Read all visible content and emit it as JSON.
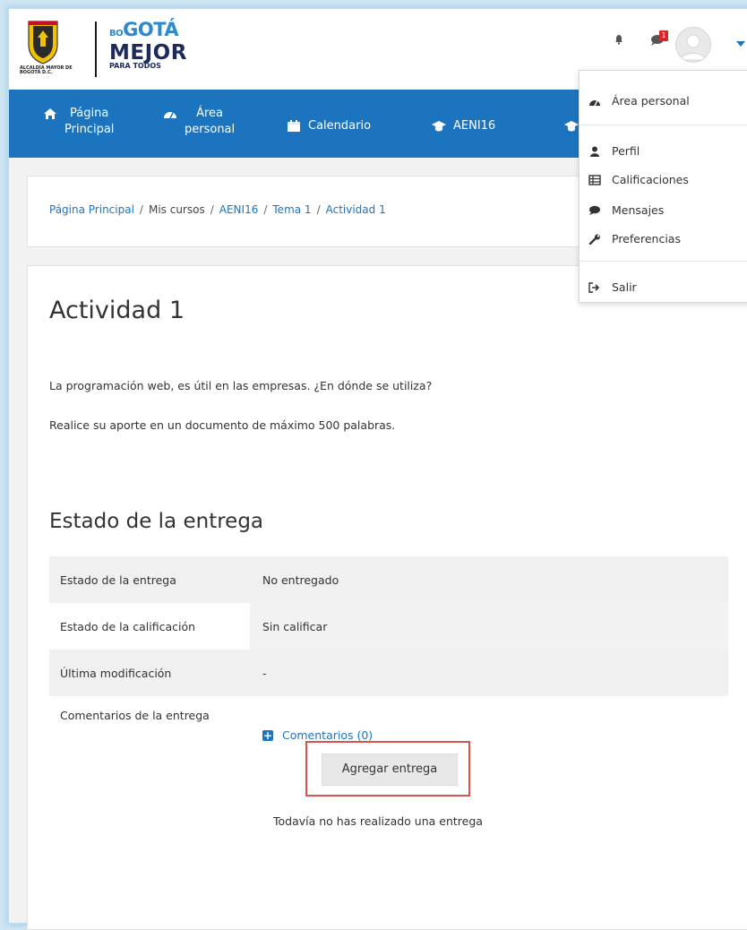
{
  "logo": {
    "crest_caption": "ALCALDÍA MAYOR DE BOGOTÁ D.C.",
    "brand_line1_prefix": "BO",
    "brand_line1": "GOTÁ",
    "brand_line2": "MEJOR",
    "brand_line3": "PARA TODOS"
  },
  "header": {
    "notification_count": "1"
  },
  "nav": {
    "items": [
      {
        "label": "Página Principal",
        "line1": "Página",
        "line2": "Principal",
        "icon": "home-icon"
      },
      {
        "label": "Área personal",
        "line1": "Área",
        "line2": "personal",
        "icon": "dashboard-icon"
      },
      {
        "label": "Calendario",
        "icon": "calendar-icon"
      },
      {
        "label": "AENI16",
        "icon": "graduation-cap-icon"
      }
    ]
  },
  "breadcrumb": {
    "items": [
      "Página Principal",
      "Mis cursos",
      "AENI16",
      "Tema 1",
      "Actividad 1"
    ],
    "separator": "/"
  },
  "page": {
    "title": "Actividad 1",
    "description_1": "La programación web, es útil en las empresas. ¿En dónde se utiliza?",
    "description_2": "Realice su aporte en un documento de máximo 500 palabras."
  },
  "submission": {
    "section_title": "Estado de la entrega",
    "rows": [
      {
        "label": "Estado de la entrega",
        "value": "No entregado"
      },
      {
        "label": "Estado de la calificación",
        "value": "Sin calificar"
      },
      {
        "label": "Última modificación",
        "value": "-"
      },
      {
        "label": "Comentarios de la entrega",
        "value": "Comentarios (0)"
      }
    ],
    "add_button": "Agregar entrega",
    "note": "Todavía no has realizado una entrega"
  },
  "user_menu": {
    "items": [
      {
        "label": "Área personal",
        "icon": "dashboard-icon"
      },
      {
        "label": "Perfil",
        "icon": "user-icon"
      },
      {
        "label": "Calificaciones",
        "icon": "table-icon"
      },
      {
        "label": "Mensajes",
        "icon": "chat-bubble-icon"
      },
      {
        "label": "Preferencias",
        "icon": "wrench-icon"
      },
      {
        "label": "Salir",
        "icon": "sign-out-icon"
      }
    ]
  },
  "colors": {
    "primary": "#1d74be",
    "badge": "#d9262b",
    "highlight_border": "#d9534f"
  }
}
